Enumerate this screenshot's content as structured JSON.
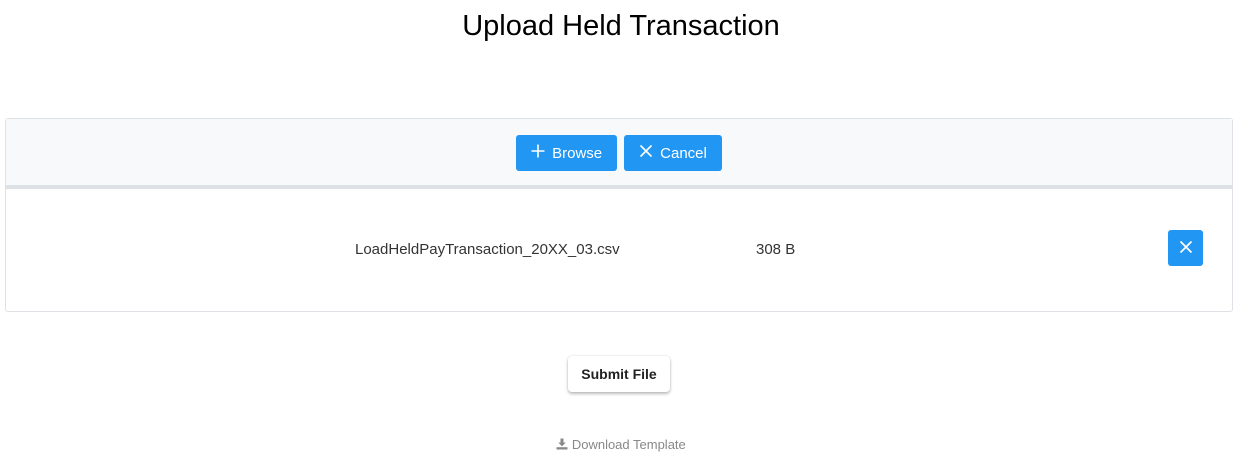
{
  "page": {
    "title": "Upload Held Transaction"
  },
  "uploader": {
    "browse_label": "Browse",
    "cancel_label": "Cancel",
    "files": [
      {
        "name": "LoadHeldPayTransaction_20XX_03.csv",
        "size": "308 B"
      }
    ]
  },
  "actions": {
    "submit_label": "Submit File",
    "download_template_label": "Download Template"
  },
  "icons": {
    "browse": "plus-icon",
    "cancel": "close-icon",
    "remove": "close-icon",
    "download": "download-icon"
  },
  "colors": {
    "primary": "#2196f3",
    "header_bg": "#f8f9fa",
    "border": "#dee2e6",
    "muted_link": "#888888"
  }
}
